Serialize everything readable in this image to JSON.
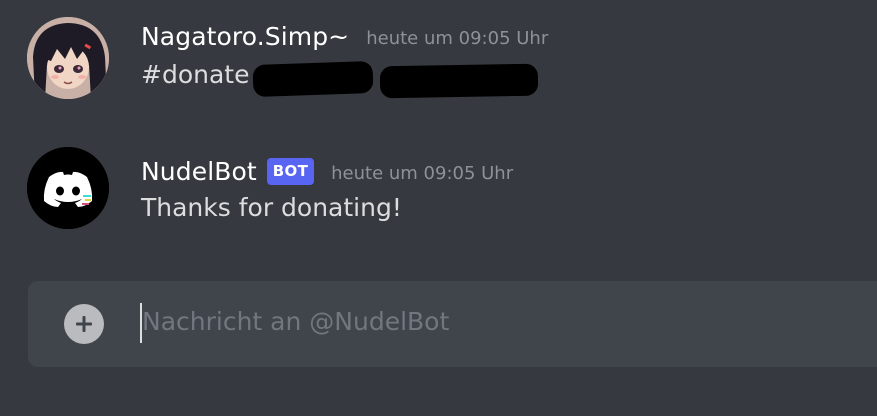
{
  "messages": [
    {
      "username": "Nagatoro.Simp~",
      "timestamp": "heute um 09:05 Uhr",
      "content": "#donate",
      "avatar_icon": "anime-girl-avatar-icon"
    },
    {
      "username": "NudelBot",
      "bot_tag": "BOT",
      "timestamp": "heute um 09:05 Uhr",
      "content": "Thanks for donating!",
      "avatar_icon": "discord-logo-icon"
    }
  ],
  "composer": {
    "placeholder": "Nachricht an @NudelBot",
    "add_icon": "plus-circle-icon"
  },
  "colors": {
    "background": "#36393f",
    "composer": "#40444b",
    "username": "#ffffff",
    "timestamp": "#8e9297",
    "message_text": "#dcddde",
    "bot_tag": "#5865f2",
    "placeholder": "#72767d"
  }
}
